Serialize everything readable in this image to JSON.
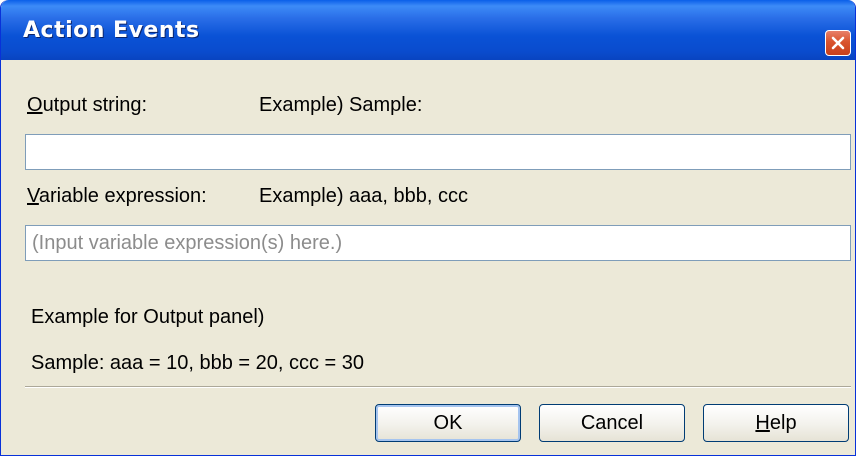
{
  "window": {
    "title": "Action Events"
  },
  "output_string": {
    "label_mnemonic": "O",
    "label_rest": "utput string:",
    "example": "Example) Sample:",
    "value": ""
  },
  "variable_expression": {
    "label_mnemonic": "V",
    "label_rest": "ariable expression:",
    "example": "Example) aaa, bbb, ccc",
    "placeholder": "(Input variable expression(s) here.)"
  },
  "output_panel_example": {
    "heading": "Example for Output panel)",
    "sample": "Sample: aaa = 10, bbb = 20, ccc = 30"
  },
  "buttons": {
    "ok_label": "OK",
    "cancel_label": "Cancel",
    "help_mnemonic": "H",
    "help_rest": "elp"
  },
  "colors": {
    "title_bar": "#0a52d6",
    "dialog_background": "#ece9d8",
    "close_button": "#d9542e",
    "input_border": "#7f9db9",
    "placeholder_text": "#8c8c8c"
  },
  "icons": {
    "close": "close-icon"
  }
}
